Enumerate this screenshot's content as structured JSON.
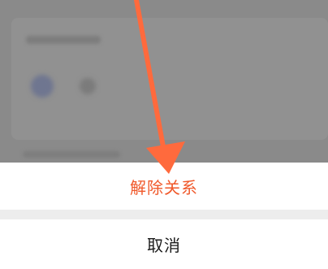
{
  "action_sheet": {
    "remove_relation_label": "解除关系",
    "cancel_label": "取消"
  },
  "colors": {
    "accent_text": "#f0582a",
    "annotation_arrow": "#ff6a3d",
    "dim_overlay": "#8a8a8a"
  },
  "annotation": {
    "icon": "arrow-down-icon"
  }
}
